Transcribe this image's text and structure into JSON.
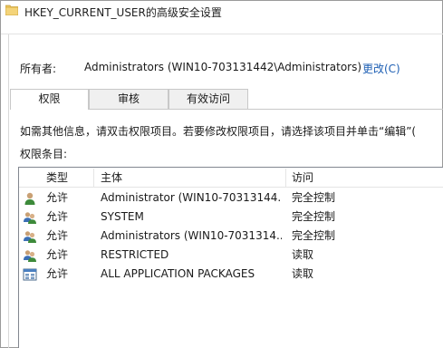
{
  "window": {
    "title": "HKEY_CURRENT_USER的高级安全设置"
  },
  "owner": {
    "label": "所有者:",
    "value": "Administrators (WIN10-703131442\\Administrators)",
    "change": "更改(C)"
  },
  "tabs": [
    {
      "label": "权限",
      "active": true
    },
    {
      "label": "审核",
      "active": false
    },
    {
      "label": "有效访问",
      "active": false
    }
  ],
  "info": "如需其他信息，请双击权限项目。若要修改权限项目，请选择该项目并单击“编辑”(",
  "entries_label": "权限条目:",
  "list": {
    "columns": [
      "类型",
      "主体",
      "访问"
    ],
    "rows": [
      {
        "icon": "user-icon",
        "type": "允许",
        "principal": "Administrator (WIN10-70313144...",
        "access": "完全控制"
      },
      {
        "icon": "users-group-icon",
        "type": "允许",
        "principal": "SYSTEM",
        "access": "完全控制"
      },
      {
        "icon": "users-group-icon",
        "type": "允许",
        "principal": "Administrators (WIN10-7031314...",
        "access": "完全控制"
      },
      {
        "icon": "users-group-icon",
        "type": "允许",
        "principal": "RESTRICTED",
        "access": "读取"
      },
      {
        "icon": "app-packages-icon",
        "type": "允许",
        "principal": "ALL APPLICATION PACKAGES",
        "access": "读取"
      }
    ]
  },
  "colors": {
    "link": "#1e5fb4",
    "folder": "#e8c15a",
    "user_green": "#3d8a3a",
    "user_blue": "#3b6fb6"
  }
}
